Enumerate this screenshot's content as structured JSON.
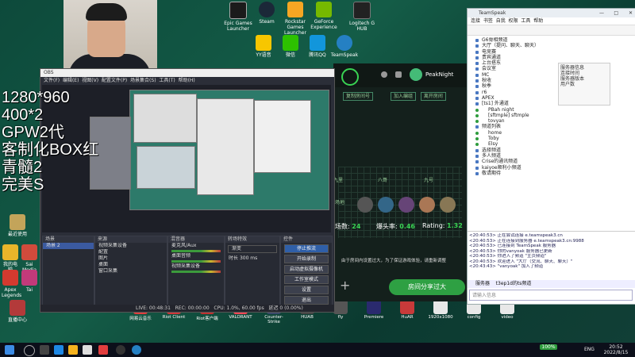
{
  "desktop_icons_top": [
    {
      "label": "Epic Games Launcher",
      "color": "#1b1b1b"
    },
    {
      "label": "Steam",
      "color": "#1b2838"
    },
    {
      "label": "Rockstar Games Launcher",
      "color": "#f5a623"
    },
    {
      "label": "GeForce Experience",
      "color": "#76b900"
    },
    {
      "label": "Logitech G HUB",
      "color": "#222222"
    },
    {
      "label": "YY语音",
      "color": "#f7c600"
    },
    {
      "label": "微信",
      "color": "#2dc100"
    },
    {
      "label": "腾讯QQ",
      "color": "#1296db"
    },
    {
      "label": "TeamSpeak",
      "color": "#2580c3"
    }
  ],
  "desktop_icons_left": [
    {
      "label": "最近使用",
      "color": "#c3a45a"
    },
    {
      "label": "我的电脑",
      "color": "#e8b52a"
    },
    {
      "label": "Sai Media",
      "color": "#d14b3c"
    },
    {
      "label": "Apex Legends",
      "color": "#d33a2f"
    },
    {
      "label": "Tai",
      "color": "#c23a7a"
    },
    {
      "label": "直播中心",
      "color": "#b33a3a"
    }
  ],
  "overlay": {
    "line1": "1280*960",
    "line2": "400*2",
    "line3": "GPW2代",
    "line4": "客制化BOX红",
    "line5": "青髓2",
    "line6": "完美S"
  },
  "obs": {
    "title": "OBS",
    "menu": [
      "文件(F)",
      "编辑(E)",
      "视图(V)",
      "配置文件(P)",
      "场景集合(S)",
      "工具(T)",
      "帮助(H)"
    ],
    "docks": {
      "scenes": {
        "header": "场景",
        "items": [
          "场景 2"
        ]
      },
      "sources": {
        "header": "来源",
        "items": [
          "视频采集设备",
          "配置",
          "图片",
          "桌面",
          "窗口采集"
        ]
      },
      "mixer": {
        "header": "混音器",
        "items": [
          "麦克风/Aux",
          "桌面音频",
          "视频采集设备"
        ]
      },
      "transitions": {
        "header": "转场特效",
        "mode": "渐变",
        "duration_label": "时长",
        "duration": "300 ms"
      },
      "controls": {
        "header": "控件",
        "buttons": [
          "停止推流",
          "开始录制",
          "启动虚拟摄像机",
          "工作室模式",
          "设置",
          "退出"
        ]
      }
    },
    "status": {
      "drops": "丢帧 0 (0.0%)",
      "live": "LIVE: 00:48:31",
      "rec": "REC: 00:00:00",
      "cpu": "CPU: 1.0%, 60.00 fps",
      "dropped": "延迟 0 (0.00%)"
    }
  },
  "game_client": {
    "username": "PeakNight",
    "buttons": [
      "复制房间号",
      "加入编组",
      "离开房间"
    ],
    "maps": [
      "九里",
      "八哥",
      "九号"
    ],
    "pool_label": "场地",
    "stats": [
      {
        "label": "场数:",
        "value": "24"
      },
      {
        "label": "爆头率:",
        "value": "0.46"
      },
      {
        "label": "Rating:",
        "value": "1.32"
      }
    ],
    "main_button": "房间分享过大",
    "notice": "由于房间内设置过大，为了保证游戏体验，请重新调整"
  },
  "teamspeak": {
    "title": "TeamSpeak",
    "menu": [
      "连接",
      "书签",
      "自我",
      "权限",
      "工具",
      "帮助"
    ],
    "tabs": [
      "TeamSpeak",
      "YYA"
    ],
    "tree": [
      {
        "label": "G6骨相频道",
        "type": "channel"
      },
      {
        "label": "大厅（提问、聊天、聊天）",
        "type": "channel"
      },
      {
        "label": "电竞赛",
        "type": "channel"
      },
      {
        "label": "贵宾通道",
        "type": "channel"
      },
      {
        "label": "上台搭东",
        "type": "channel"
      },
      {
        "label": "会议室",
        "type": "channel"
      },
      {
        "label": "MC",
        "type": "channel"
      },
      {
        "label": "秋收",
        "type": "channel"
      },
      {
        "label": "秋季",
        "type": "channel"
      },
      {
        "label": "r6",
        "type": "channel"
      },
      {
        "label": "APEX",
        "type": "channel"
      },
      {
        "label": "[ts1] 外通道",
        "type": "channel"
      },
      {
        "label": "PBah night",
        "type": "user"
      },
      {
        "label": "[sftmple] sftmple",
        "type": "user"
      },
      {
        "label": "tovyan",
        "type": "user"
      },
      {
        "label": "频道列表",
        "type": "channel"
      },
      {
        "label": "home",
        "type": "user"
      },
      {
        "label": "Toby",
        "type": "user"
      },
      {
        "label": "Elsy",
        "type": "user"
      },
      {
        "label": "选择频道",
        "type": "channel"
      },
      {
        "label": "多人频道",
        "type": "channel"
      },
      {
        "label": "Crise的通讯频道",
        "type": "channel"
      },
      {
        "label": "kaiyoe顺利小频道",
        "type": "channel"
      },
      {
        "label": "敬请期待",
        "type": "channel"
      }
    ],
    "info_box": [
      "服务器信息",
      "连接时间",
      "服务器版本",
      "用户数"
    ],
    "chat": [
      "<20:40:53> 正在尝试连接 e.teamspeak3.cn",
      "<20:40:53> 正在连接到服务器 e.teamspeak3.cn:9988",
      "<20:40:53> 已连接到 TeamSpeak 服务器",
      "<20:40:53> 你的vanyoak 服务器已更新",
      "<20:40:53> 你进入了频道 \"主页频道\"",
      "<20:40:53> 欢迎进入 \"大厅（交流、聊天、聊天）\"",
      "<20:43:43> \"vanyoak\" 加入了频道"
    ],
    "chat_tabs": [
      "服务器",
      "t3ep1d的ts频道"
    ],
    "chat_input_placeholder": "请输入信息",
    "status_right": "连接用户 PBah night"
  },
  "bottom_apps": [
    "网易云音乐",
    "Riot Client",
    "Riot客户端",
    "VALORANT",
    "Counter-Strike",
    "HUAB",
    "fly",
    "Premiere",
    "HuAR",
    "1920x1080",
    "config",
    "video"
  ],
  "taskbar": {
    "time": "20:52",
    "date": "2022/8/15",
    "lang": "ENG",
    "battery_percent": "100%"
  }
}
